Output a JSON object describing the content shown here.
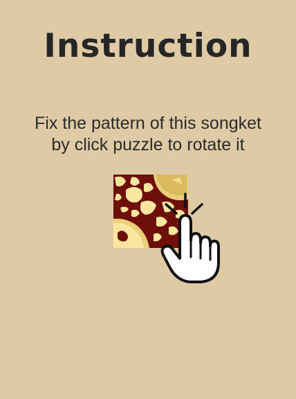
{
  "screen": {
    "background": "#dfcaa6"
  },
  "title": "Instruction",
  "instruction": {
    "line1": "Fix the pattern of this songket",
    "line2": "by click puzzle to rotate it"
  },
  "icons": {
    "puzzle_tile": "songket-tile-icon",
    "tap_hand": "pointing-hand-icon"
  },
  "colors": {
    "text": "#262626",
    "songket_maroon": "#6e0f0a",
    "songket_gold": "#e9cf78",
    "songket_cream": "#fbe59f"
  }
}
